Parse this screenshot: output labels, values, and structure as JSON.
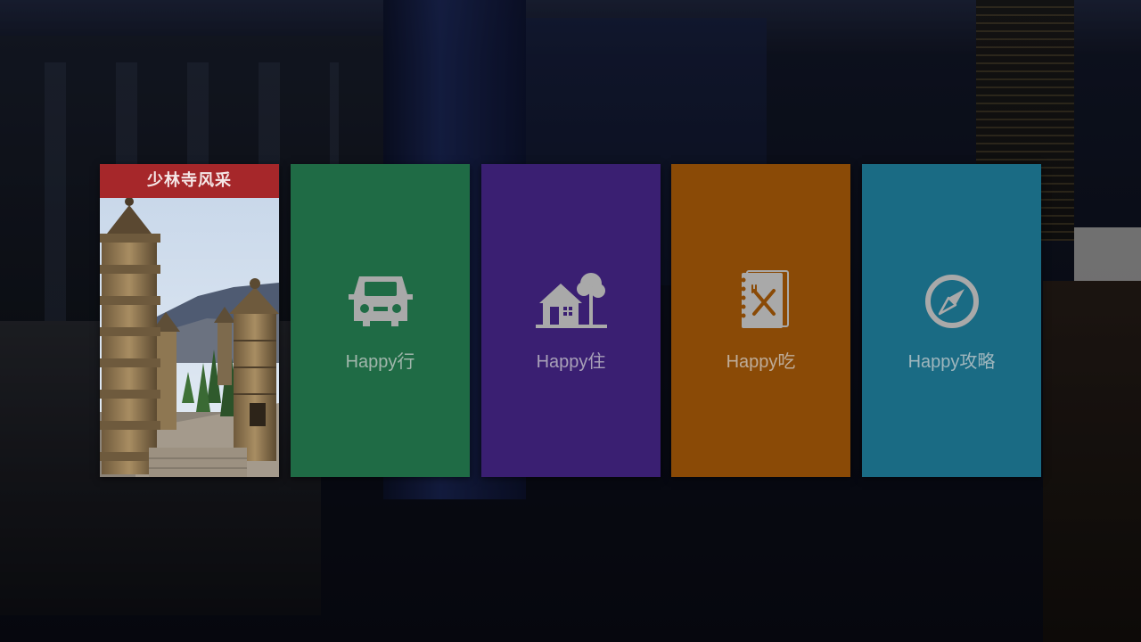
{
  "tiles": [
    {
      "id": "photo",
      "header": "少林寺风采",
      "image_desc": "pagoda-forest-photo"
    },
    {
      "id": "car",
      "label": "Happy行",
      "icon": "car-icon",
      "color": "#1f6b45"
    },
    {
      "id": "house",
      "label": "Happy住",
      "icon": "house-icon",
      "color": "#3a1f72"
    },
    {
      "id": "food",
      "label": "Happy吃",
      "icon": "menu-icon",
      "color": "#8a4a06"
    },
    {
      "id": "guide",
      "label": "Happy攻略",
      "icon": "compass-icon",
      "color": "#1a6b84"
    }
  ],
  "colors": {
    "photo_header": "#a6272a",
    "icon_gray": "#a9a9a9"
  }
}
